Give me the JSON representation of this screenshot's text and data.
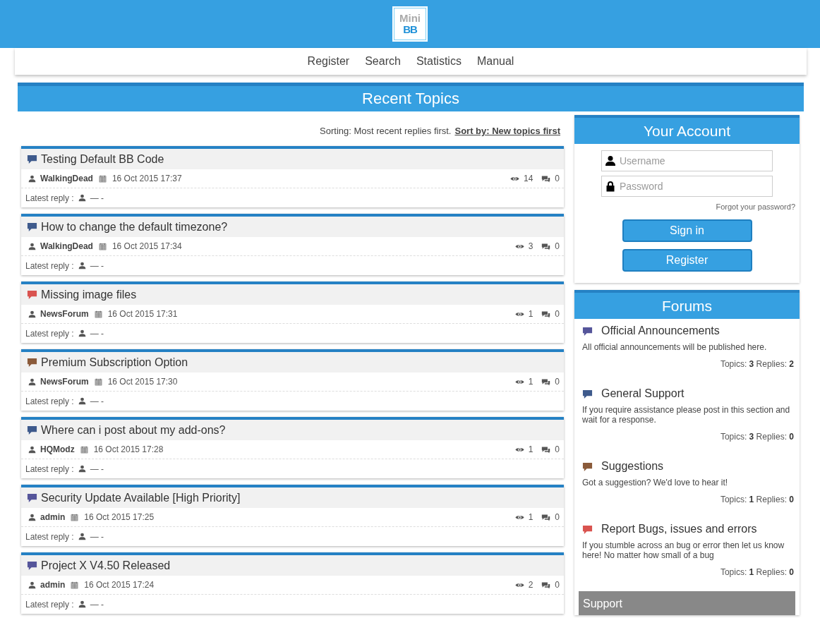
{
  "logo": {
    "top": "Mini",
    "bottom": "BB"
  },
  "nav": [
    "Register",
    "Search",
    "Statistics",
    "Manual"
  ],
  "section_title": "Recent Topics",
  "sorting": {
    "label": "Sorting: Most recent replies first.",
    "link": "Sort by: New topics first"
  },
  "topics": [
    {
      "title": "Testing Default BB Code",
      "color": "#3e5a8c",
      "author": "WalkingDead",
      "date": "16 Oct 2015 17:37",
      "views": "14",
      "replies": "0",
      "latest_label": "Latest reply :",
      "latest": "— -"
    },
    {
      "title": "How to change the default timezone?",
      "color": "#3e5a8c",
      "author": "WalkingDead",
      "date": "16 Oct 2015 17:34",
      "views": "3",
      "replies": "0",
      "latest_label": "Latest reply :",
      "latest": "— -"
    },
    {
      "title": "Missing image files",
      "color": "#d9534f",
      "author": "NewsForum",
      "date": "16 Oct 2015 17:31",
      "views": "1",
      "replies": "0",
      "latest_label": "Latest reply :",
      "latest": "— -"
    },
    {
      "title": "Premium Subscription Option",
      "color": "#8a5a3a",
      "author": "NewsForum",
      "date": "16 Oct 2015 17:30",
      "views": "1",
      "replies": "0",
      "latest_label": "Latest reply :",
      "latest": "— -"
    },
    {
      "title": "Where can i post about my add-ons?",
      "color": "#3e5a8c",
      "author": "HQModz",
      "date": "16 Oct 2015 17:28",
      "views": "1",
      "replies": "0",
      "latest_label": "Latest reply :",
      "latest": "— -"
    },
    {
      "title": "Security Update Available [High Priority]",
      "color": "#55559a",
      "author": "admin",
      "date": "16 Oct 2015 17:25",
      "views": "1",
      "replies": "0",
      "latest_label": "Latest reply :",
      "latest": "— -"
    },
    {
      "title": "Project X V4.50 Released",
      "color": "#55559a",
      "author": "admin",
      "date": "16 Oct 2015 17:24",
      "views": "2",
      "replies": "0",
      "latest_label": "Latest reply :",
      "latest": "— -"
    }
  ],
  "account": {
    "title": "Your Account",
    "username_placeholder": "Username",
    "password_placeholder": "Password",
    "forgot": "Forgot your password?",
    "buttons": [
      "Sign in",
      "Register"
    ]
  },
  "forums": {
    "title": "Forums",
    "items": [
      {
        "name": "Official Announcements",
        "color": "#55559a",
        "description": "All official announcements will be published here.",
        "stats": "Topics: **3** Replies: **2**"
      },
      {
        "name": "General Support",
        "color": "#3e5a8c",
        "description": "If you require assistance please post in this section and wait for a response.",
        "stats": "Topics: **3** Replies: **0**"
      },
      {
        "name": "Suggestions",
        "color": "#8a5a3a",
        "description": "Got a suggestion? We'd love to hear it!",
        "stats": "Topics: **1** Replies: **0**"
      },
      {
        "name": "Report Bugs, issues and errors",
        "color": "#d9534f",
        "description": "If you stumble across an bug or error then let us know here! No matter how small of a bug",
        "stats": "Topics: **1** Replies: **0**"
      }
    ],
    "category": "Support"
  }
}
